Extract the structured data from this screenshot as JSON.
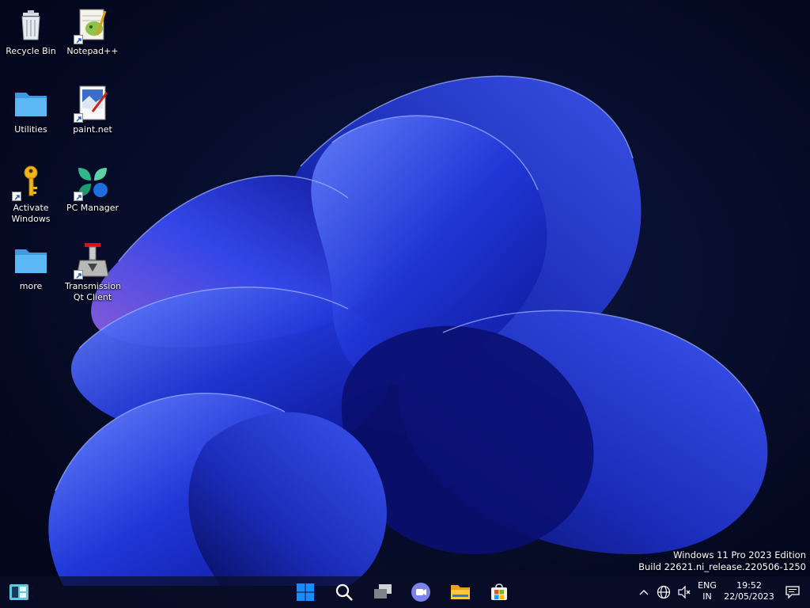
{
  "desktop": {
    "icons": [
      {
        "label": "Recycle Bin"
      },
      {
        "label": "Notepad++"
      },
      {
        "label": "Utilities"
      },
      {
        "label": "paint.net"
      },
      {
        "label": "Activate Windows"
      },
      {
        "label": "PC Manager"
      },
      {
        "label": "more"
      },
      {
        "label": "Transmission Qt Client"
      }
    ]
  },
  "watermark": {
    "line1": "Windows 11 Pro 2023 Edition",
    "line2": "Build 22621.ni_release.220506-1250"
  },
  "taskbar": {
    "pinned": [
      {
        "icon": "widgets-icon"
      },
      {
        "icon": "windows-start-icon"
      },
      {
        "icon": "search-icon"
      },
      {
        "icon": "task-view-icon"
      },
      {
        "icon": "teams-chat-icon"
      },
      {
        "icon": "file-explorer-icon"
      },
      {
        "icon": "microsoft-store-icon"
      }
    ],
    "tray": {
      "language_line1": "ENG",
      "language_line2": "IN",
      "time": "19:52",
      "date": "22/05/2023"
    }
  },
  "colors": {
    "taskbar_bg": "#0a0e28",
    "wallpaper_base": "#050a1f",
    "bloom_blue": "#1f3ad8",
    "accent": "#0078d4"
  }
}
